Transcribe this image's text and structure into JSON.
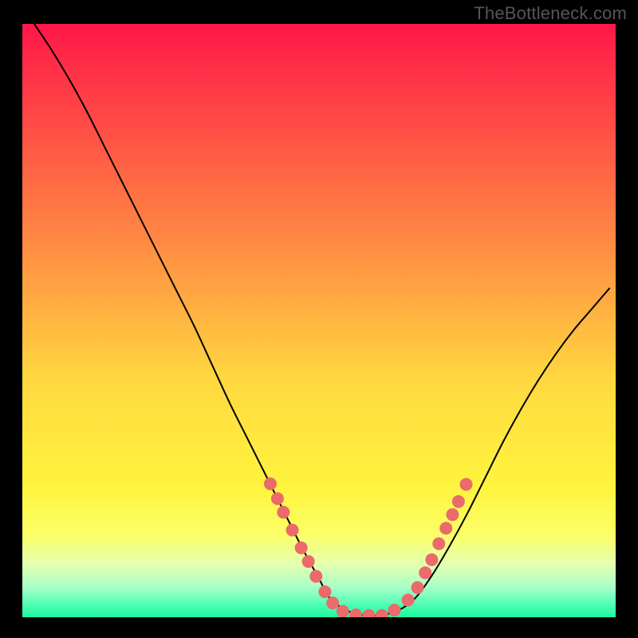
{
  "attribution": "TheBottleneck.com",
  "chart_data": {
    "type": "line",
    "title": "",
    "xlabel": "",
    "ylabel": "",
    "xlim": [
      0,
      1
    ],
    "ylim": [
      0,
      1
    ],
    "legend": false,
    "grid": false,
    "background_gradient_stops": [
      {
        "offset": 0.0,
        "color": "#ff1748"
      },
      {
        "offset": 0.38,
        "color": "#ff8e43"
      },
      {
        "offset": 0.6,
        "color": "#ffd83f"
      },
      {
        "offset": 0.78,
        "color": "#fff43e"
      },
      {
        "offset": 0.86,
        "color": "#fbff66"
      },
      {
        "offset": 0.91,
        "color": "#e5ffb0"
      },
      {
        "offset": 0.95,
        "color": "#a8ffc7"
      },
      {
        "offset": 0.98,
        "color": "#4bffb2"
      },
      {
        "offset": 1.0,
        "color": "#1ff7a0"
      }
    ],
    "series": [
      {
        "name": "bottleneck-curve",
        "color": "#000000",
        "stroke_width": 2,
        "x": [
          0.02,
          0.05,
          0.08,
          0.11,
          0.14,
          0.17,
          0.2,
          0.23,
          0.26,
          0.29,
          0.32,
          0.35,
          0.38,
          0.41,
          0.44,
          0.47,
          0.5,
          0.52,
          0.55,
          0.58,
          0.6,
          0.63,
          0.66,
          0.69,
          0.72,
          0.75,
          0.78,
          0.81,
          0.84,
          0.87,
          0.9,
          0.93,
          0.96,
          0.99
        ],
        "y": [
          1.0,
          0.955,
          0.905,
          0.85,
          0.79,
          0.73,
          0.67,
          0.61,
          0.55,
          0.49,
          0.425,
          0.36,
          0.3,
          0.24,
          0.18,
          0.12,
          0.065,
          0.03,
          0.01,
          0.003,
          0.003,
          0.01,
          0.03,
          0.07,
          0.12,
          0.175,
          0.235,
          0.295,
          0.35,
          0.4,
          0.445,
          0.485,
          0.52,
          0.555
        ]
      }
    ],
    "markers": {
      "name": "highlight-dots",
      "color": "#eb6a6a",
      "radius": 8,
      "points": [
        {
          "x": 0.418,
          "y": 0.225
        },
        {
          "x": 0.43,
          "y": 0.2
        },
        {
          "x": 0.44,
          "y": 0.177
        },
        {
          "x": 0.455,
          "y": 0.147
        },
        {
          "x": 0.47,
          "y": 0.117
        },
        {
          "x": 0.482,
          "y": 0.094
        },
        {
          "x": 0.495,
          "y": 0.069
        },
        {
          "x": 0.51,
          "y": 0.043
        },
        {
          "x": 0.523,
          "y": 0.024
        },
        {
          "x": 0.54,
          "y": 0.01
        },
        {
          "x": 0.562,
          "y": 0.004
        },
        {
          "x": 0.584,
          "y": 0.003
        },
        {
          "x": 0.606,
          "y": 0.003
        },
        {
          "x": 0.627,
          "y": 0.012
        },
        {
          "x": 0.65,
          "y": 0.029
        },
        {
          "x": 0.666,
          "y": 0.05
        },
        {
          "x": 0.679,
          "y": 0.075
        },
        {
          "x": 0.69,
          "y": 0.097
        },
        {
          "x": 0.702,
          "y": 0.124
        },
        {
          "x": 0.714,
          "y": 0.15
        },
        {
          "x": 0.725,
          "y": 0.173
        },
        {
          "x": 0.735,
          "y": 0.195
        },
        {
          "x": 0.748,
          "y": 0.224
        }
      ]
    }
  }
}
